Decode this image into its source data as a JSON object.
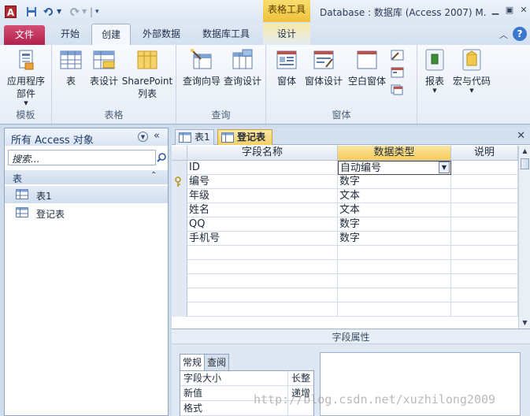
{
  "title_bar": {
    "app_letter": "A",
    "context_tab_header": "表格工具",
    "window_title": "Database : 数据库 (Access 2007) M."
  },
  "tabs": [
    "文件",
    "开始",
    "创建",
    "外部数据",
    "数据库工具",
    "设计"
  ],
  "active_tab": "创建",
  "ribbon": {
    "groups": [
      {
        "label": "模板",
        "buttons": [
          "应用程序\n部件"
        ]
      },
      {
        "label": "表格",
        "buttons": [
          "表",
          "表设计",
          "SharePoint\n列表"
        ]
      },
      {
        "label": "查询",
        "buttons": [
          "查询向导",
          "查询设计"
        ]
      },
      {
        "label": "窗体",
        "buttons": [
          "窗体",
          "窗体设计",
          "空白窗体"
        ]
      },
      {
        "label": "",
        "buttons": [
          "报表",
          "宏与代码"
        ]
      }
    ]
  },
  "nav_pane": {
    "title": "所有 Access 对象",
    "search_placeholder": "搜索...",
    "section": "表",
    "items": [
      "表1",
      "登记表"
    ]
  },
  "document": {
    "tabs": [
      "表1",
      "登记表"
    ],
    "active_tab": "登记表",
    "columns": [
      "字段名称",
      "数据类型",
      "说明"
    ],
    "rows": [
      {
        "name": "ID",
        "type": "自动编号",
        "desc": ""
      },
      {
        "name": "编号",
        "type": "数字",
        "desc": "",
        "primary_key": true
      },
      {
        "name": "年级",
        "type": "文本",
        "desc": ""
      },
      {
        "name": "姓名",
        "type": "文本",
        "desc": ""
      },
      {
        "name": "QQ",
        "type": "数字",
        "desc": ""
      },
      {
        "name": "手机号",
        "type": "数字",
        "desc": ""
      }
    ],
    "field_properties": {
      "header": "字段属性",
      "tabs": [
        "常规",
        "查阅"
      ],
      "properties": [
        {
          "key": "字段大小",
          "value": "长整"
        },
        {
          "key": "新值",
          "value": "递增"
        },
        {
          "key": "格式",
          "value": ""
        }
      ]
    }
  },
  "watermark": "http://blog.csdn.net/xuzhilong2009",
  "colors": {
    "file_tab": "#b3214c",
    "context_yellow": "#f2cf66",
    "ribbon_bg": "#e6edf6"
  }
}
